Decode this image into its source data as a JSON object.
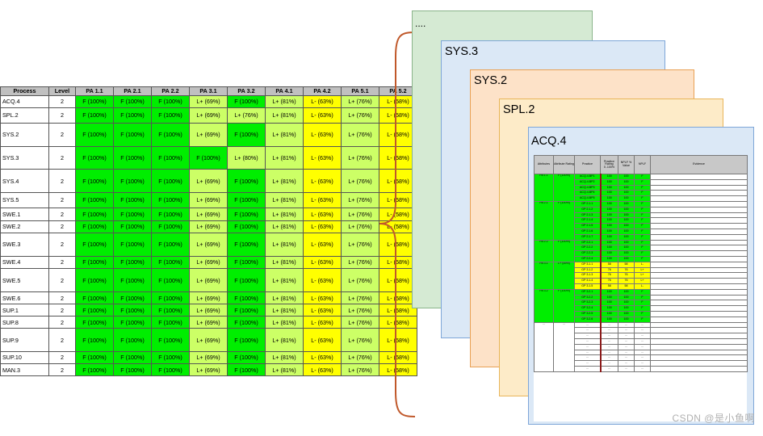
{
  "table": {
    "headers": [
      "Process",
      "Level",
      "PA 1.1",
      "PA 2.1",
      "PA 2.2",
      "PA 3.1",
      "PA 3.2",
      "PA 4.1",
      "PA 4.2",
      "PA 5.1",
      "PA 5.2"
    ],
    "rows": [
      {
        "process": "ACQ.4",
        "level": "2",
        "cells": [
          "F (100%)",
          "F (100%)",
          "F (100%)",
          "L+ (69%)",
          "F (100%)",
          "L+ (81%)",
          "L- (63%)",
          "L+ (76%)",
          "L- (58%)"
        ],
        "h": 1
      },
      {
        "process": "SPL.2",
        "level": "2",
        "cells": [
          "F (100%)",
          "F (100%)",
          "F (100%)",
          "L+ (69%)",
          "L+ (76%)",
          "L+ (81%)",
          "L- (63%)",
          "L+ (76%)",
          "L- (58%)"
        ],
        "h": 1.25
      },
      {
        "process": "SYS.2",
        "level": "2",
        "cells": [
          "F (100%)",
          "F (100%)",
          "F (100%)",
          "L+ (69%)",
          "F (100%)",
          "L+ (81%)",
          "L- (63%)",
          "L+ (76%)",
          "L- (58%)"
        ],
        "h": 1.9
      },
      {
        "process": "SYS.3",
        "level": "2",
        "cells": [
          "F (100%)",
          "F (100%)",
          "F (100%)",
          "F (100%)",
          "L+ (80%)",
          "L+ (81%)",
          "L- (63%)",
          "L+ (76%)",
          "L- (58%)"
        ],
        "h": 1.9
      },
      {
        "process": "SYS.4",
        "level": "2",
        "cells": [
          "F (100%)",
          "F (100%)",
          "F (100%)",
          "L+ (69%)",
          "F (100%)",
          "L+ (81%)",
          "L- (63%)",
          "L+ (76%)",
          "L- (58%)"
        ],
        "h": 1.9
      },
      {
        "process": "SYS.5",
        "level": "2",
        "cells": [
          "F (100%)",
          "F (100%)",
          "F (100%)",
          "L+ (69%)",
          "F (100%)",
          "L+ (81%)",
          "L- (63%)",
          "L+ (76%)",
          "L- (58%)"
        ],
        "h": 1.25
      },
      {
        "process": "SWE.1",
        "level": "2",
        "cells": [
          "F (100%)",
          "F (100%)",
          "F (100%)",
          "L+ (69%)",
          "F (100%)",
          "L+ (81%)",
          "L- (63%)",
          "L+ (76%)",
          "L- (58%)"
        ],
        "h": 1.05
      },
      {
        "process": "SWE.2",
        "level": "2",
        "cells": [
          "F (100%)",
          "F (100%)",
          "F (100%)",
          "L+ (69%)",
          "F (100%)",
          "L+ (81%)",
          "L- (63%)",
          "L+ (76%)",
          "L- (58%)"
        ],
        "h": 1
      },
      {
        "process": "SWE.3",
        "level": "2",
        "cells": [
          "F (100%)",
          "F (100%)",
          "F (100%)",
          "L+ (69%)",
          "F (100%)",
          "L+ (81%)",
          "L- (63%)",
          "L+ (76%)",
          "L- (58%)"
        ],
        "h": 1.9
      },
      {
        "process": "SWE.4",
        "level": "2",
        "cells": [
          "F (100%)",
          "F (100%)",
          "F (100%)",
          "L+ (69%)",
          "F (100%)",
          "L+ (81%)",
          "L- (63%)",
          "L+ (76%)",
          "L- (58%)"
        ],
        "h": 1.05
      },
      {
        "process": "SWE.5",
        "level": "2",
        "cells": [
          "F (100%)",
          "F (100%)",
          "F (100%)",
          "L+ (69%)",
          "F (100%)",
          "L+ (81%)",
          "L- (63%)",
          "L+ (76%)",
          "L- (58%)"
        ],
        "h": 1.9
      },
      {
        "process": "SWE.6",
        "level": "2",
        "cells": [
          "F (100%)",
          "F (100%)",
          "F (100%)",
          "L+ (69%)",
          "F (100%)",
          "L+ (81%)",
          "L- (63%)",
          "L+ (76%)",
          "L- (58%)"
        ],
        "h": 1
      },
      {
        "process": "SUP.1",
        "level": "2",
        "cells": [
          "F (100%)",
          "F (100%)",
          "F (100%)",
          "L+ (69%)",
          "F (100%)",
          "L+ (81%)",
          "L- (63%)",
          "L+ (76%)",
          "L- (58%)"
        ],
        "h": 1
      },
      {
        "process": "SUP.8",
        "level": "2",
        "cells": [
          "F (100%)",
          "F (100%)",
          "F (100%)",
          "L+ (69%)",
          "F (100%)",
          "L+ (81%)",
          "L- (63%)",
          "L+ (76%)",
          "L- (58%)"
        ],
        "h": 1
      },
      {
        "process": "SUP.9",
        "level": "2",
        "cells": [
          "F (100%)",
          "F (100%)",
          "F (100%)",
          "L+ (69%)",
          "F (100%)",
          "L+ (81%)",
          "L- (63%)",
          "L+ (76%)",
          "L- (58%)"
        ],
        "h": 1.9
      },
      {
        "process": "SUP.10",
        "level": "2",
        "cells": [
          "F (100%)",
          "F (100%)",
          "F (100%)",
          "L+ (69%)",
          "F (100%)",
          "L+ (81%)",
          "L- (63%)",
          "L+ (76%)",
          "L- (58%)"
        ],
        "h": 1
      },
      {
        "process": "MAN.3",
        "level": "2",
        "cells": [
          "F (100%)",
          "F (100%)",
          "F (100%)",
          "L+ (69%)",
          "F (100%)",
          "L+ (81%)",
          "L- (63%)",
          "L+ (76%)",
          "L- (58%)"
        ],
        "h": 1
      }
    ]
  },
  "colors": {
    "F": "#00ee00",
    "L+": "#ccff66",
    "L-": "#ffff00",
    "brace": "#c0582a"
  },
  "cards": {
    "ellipsis": "....",
    "sys3": "SYS.3",
    "sys2": "SYS.2",
    "spl2": "SPL.2",
    "acq4": "ACQ.4"
  },
  "detail": {
    "headers": [
      "Attributes",
      "Attribute Rating",
      "Practice",
      "Practice Rating 0..100%",
      "NPLF % Value",
      "NPLF",
      "Evidence"
    ],
    "groups": [
      {
        "attr": "PA 1.1",
        "rating": "F (100%)",
        "rows": [
          [
            "ACQ.4.BP1",
            "100",
            "100",
            "F"
          ],
          [
            "ACQ.4.BP2",
            "100",
            "100",
            "F"
          ],
          [
            "ACQ.4.BP3",
            "100",
            "100",
            "F"
          ],
          [
            "ACQ.4.BP4",
            "100",
            "100",
            "F"
          ],
          [
            "ACQ.4.BP5",
            "100",
            "100",
            "F"
          ]
        ]
      },
      {
        "attr": "PA 2.1",
        "rating": "F (100%)",
        "rows": [
          [
            "GP 2.1.1",
            "100",
            "100",
            "F"
          ],
          [
            "GP 2.1.2",
            "100",
            "100",
            "F"
          ],
          [
            "GP 2.1.3",
            "100",
            "100",
            "F"
          ],
          [
            "GP 2.1.4",
            "100",
            "100",
            "F"
          ],
          [
            "GP 2.1.5",
            "100",
            "100",
            "F"
          ],
          [
            "GP 2.1.6",
            "100",
            "100",
            "F"
          ],
          [
            "GP 2.1.7",
            "100",
            "100",
            "F"
          ]
        ]
      },
      {
        "attr": "PA 2.2",
        "rating": "F (100%)",
        "rows": [
          [
            "GP 2.2.1",
            "100",
            "100",
            "F"
          ],
          [
            "GP 2.2.2",
            "100",
            "100",
            "F"
          ],
          [
            "GP 2.2.3",
            "100",
            "100",
            "F"
          ],
          [
            "GP 2.2.4",
            "100",
            "100",
            "F"
          ]
        ]
      },
      {
        "attr": "PA 3.1",
        "rating": "L+ (69%)",
        "rows": [
          [
            "GP 3.1.1",
            "58",
            "58",
            "L-"
          ],
          [
            "GP 3.1.2",
            "76",
            "76",
            "L+"
          ],
          [
            "GP 3.1.3",
            "76",
            "76",
            "L+"
          ],
          [
            "GP 3.1.4",
            "76",
            "76",
            "L+"
          ],
          [
            "GP 3.1.5",
            "58",
            "58",
            "L-"
          ]
        ]
      },
      {
        "attr": "PA 3.2",
        "rating": "F (100%)",
        "rows": [
          [
            "GP 3.2.1",
            "100",
            "100",
            "F"
          ],
          [
            "GP 3.2.2",
            "100",
            "100",
            "F"
          ],
          [
            "GP 3.2.3",
            "100",
            "100",
            "F"
          ],
          [
            "GP 3.2.4",
            "100",
            "100",
            "F"
          ],
          [
            "GP 3.2.5",
            "100",
            "100",
            "F"
          ],
          [
            "GP 3.2.6",
            "100",
            "100",
            "F"
          ]
        ]
      },
      {
        "attr": "...",
        "rating": "...",
        "rows": [
          [
            "...",
            "...",
            "...",
            "..."
          ],
          [
            "...",
            "...",
            "...",
            "..."
          ],
          [
            "...",
            "...",
            "...",
            "..."
          ],
          [
            "...",
            "...",
            "...",
            "..."
          ],
          [
            "...",
            "...",
            "...",
            "..."
          ],
          [
            "...",
            "...",
            "...",
            "..."
          ],
          [
            "...",
            "...",
            "...",
            "..."
          ],
          [
            "...",
            "...",
            "...",
            "..."
          ],
          [
            "...",
            "...",
            "...",
            "..."
          ]
        ]
      }
    ]
  },
  "watermark": "CSDN @是小鱼啊"
}
